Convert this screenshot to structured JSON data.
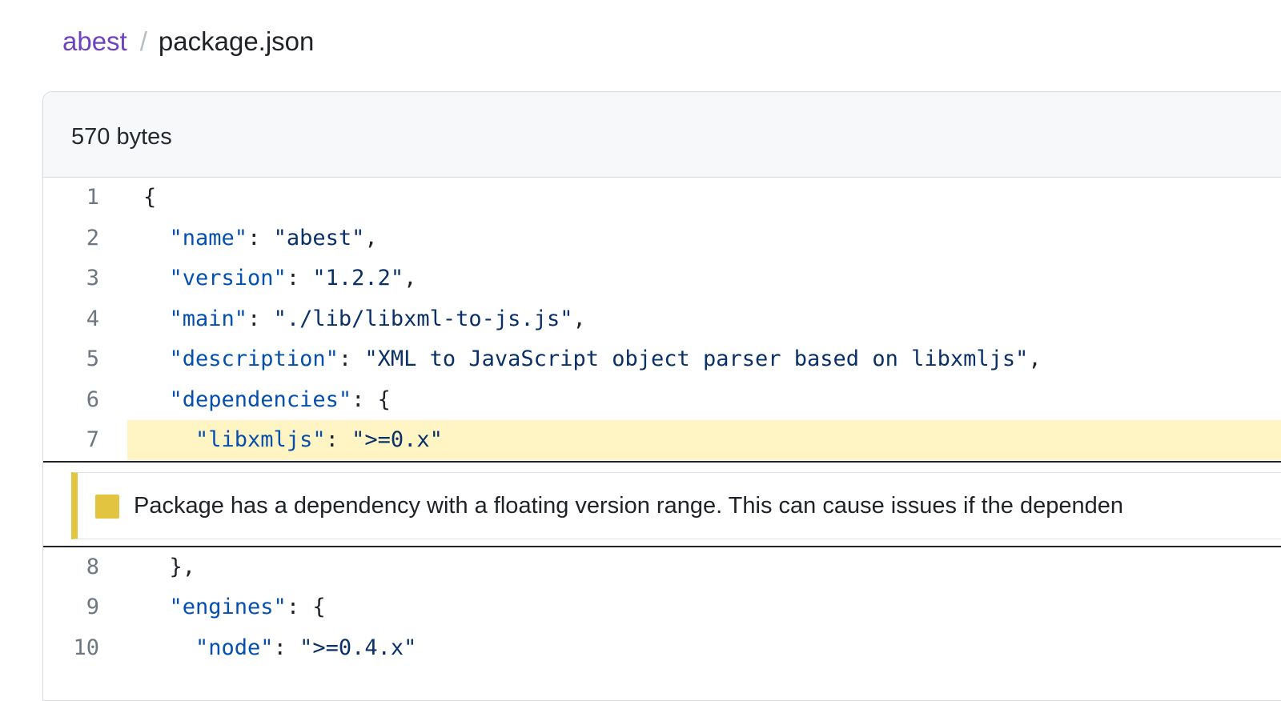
{
  "breadcrumb": {
    "repo": "abest",
    "separator": "/",
    "file": "package.json"
  },
  "file": {
    "size_label": "570 bytes"
  },
  "code_lines": [
    {
      "num": "1",
      "key": "",
      "indent": "",
      "text": "{",
      "highlight": false
    },
    {
      "num": "2",
      "indent": "  ",
      "key": "\"name\"",
      "sep": ": ",
      "value": "\"abest\"",
      "tail": ",",
      "highlight": false
    },
    {
      "num": "3",
      "indent": "  ",
      "key": "\"version\"",
      "sep": ": ",
      "value": "\"1.2.2\"",
      "tail": ",",
      "highlight": false
    },
    {
      "num": "4",
      "indent": "  ",
      "key": "\"main\"",
      "sep": ": ",
      "value": "\"./lib/libxml-to-js.js\"",
      "tail": ",",
      "highlight": false
    },
    {
      "num": "5",
      "indent": "  ",
      "key": "\"description\"",
      "sep": ": ",
      "value": "\"XML to JavaScript object parser based on libxmljs\"",
      "tail": ",",
      "highlight": false
    },
    {
      "num": "6",
      "indent": "  ",
      "key": "\"dependencies\"",
      "sep": ": ",
      "value": "",
      "tail": "{",
      "highlight": false
    },
    {
      "num": "7",
      "indent": "    ",
      "key": "\"libxmljs\"",
      "sep": ": ",
      "value": "\">=0.x\"",
      "tail": "",
      "highlight": true
    }
  ],
  "code_lines_after": [
    {
      "num": "8",
      "indent": "  ",
      "key": "",
      "sep": "",
      "value": "",
      "tail": "},",
      "highlight": false
    },
    {
      "num": "9",
      "indent": "  ",
      "key": "\"engines\"",
      "sep": ": ",
      "value": "",
      "tail": "{",
      "highlight": false
    },
    {
      "num": "10",
      "indent": "    ",
      "key": "\"node\"",
      "sep": ": ",
      "value": "\">=0.4.x\"",
      "tail": "",
      "highlight": false
    }
  ],
  "annotation": {
    "severity_color": "#e3c440",
    "text": "Package has a dependency with a floating version range. This can cause issues if the dependen"
  }
}
